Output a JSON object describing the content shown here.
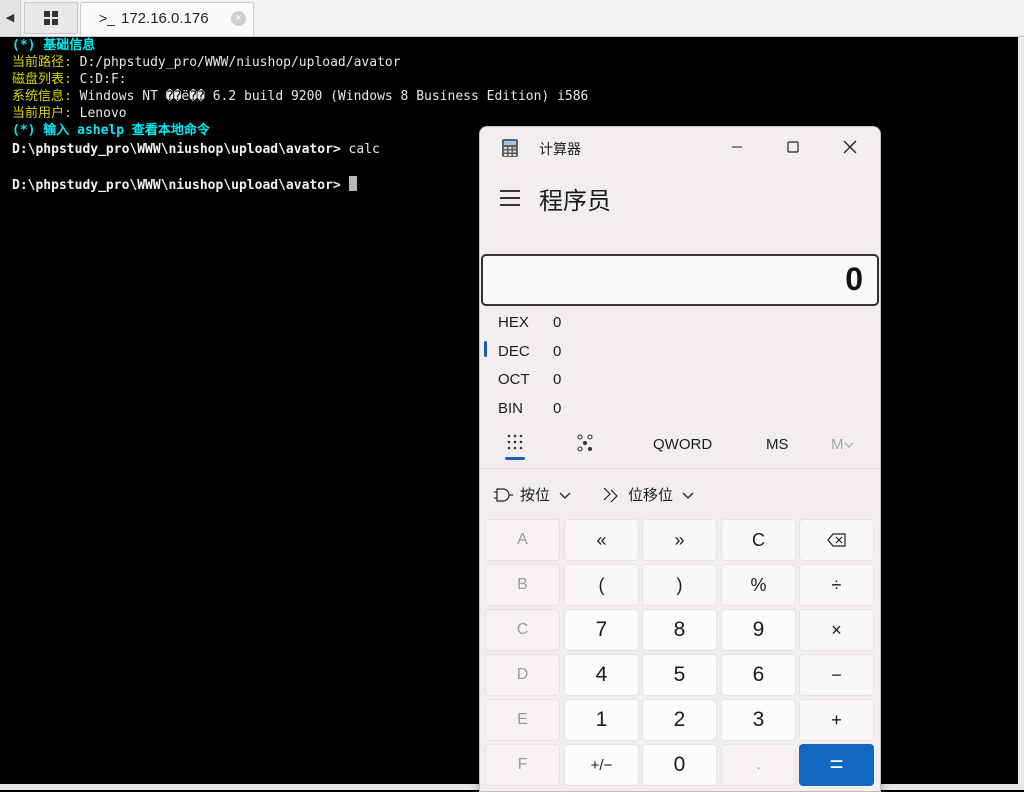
{
  "tabbar": {
    "left_arrow": "◀",
    "active_tab_icon": ">_",
    "active_tab_title": "172.16.0.176",
    "close_glyph": "×"
  },
  "terminal": {
    "line1": "(*) 基础信息",
    "line2_label": "当前路径:",
    "line2_value": " D:/phpstudy_pro/WWW/niushop/upload/avator",
    "line3_label": "磁盘列表:",
    "line3_value": " C:D:F:",
    "line4_label": "系统信息:",
    "line4_value": " Windows NT ��ë�� 6.2 build 9200 (Windows 8 Business Edition) i586",
    "line5_label": "当前用户:",
    "line5_value": " Lenovo",
    "line6": "(*) 输入 ashelp 查看本地命令",
    "prompt1": "D:\\phpstudy_pro\\WWW\\niushop\\upload\\avator> ",
    "command1": "calc",
    "prompt2": "D:\\phpstudy_pro\\WWW\\niushop\\upload\\avator> "
  },
  "calculator": {
    "window_title": "计算器",
    "mode_title": "程序员",
    "display_value": "0",
    "radix": {
      "hex_label": "HEX",
      "hex_value": "0",
      "dec_label": "DEC",
      "dec_value": "0",
      "oct_label": "OCT",
      "oct_value": "0",
      "bin_label": "BIN",
      "bin_value": "0"
    },
    "word_size": "QWORD",
    "memory_store": "MS",
    "memory_menu": "M",
    "bitwise_label": "按位",
    "bitshift_label": "位移位",
    "keys": {
      "a": "A",
      "lsh": "«",
      "rsh": "»",
      "clear": "C",
      "b": "B",
      "lparen": "(",
      "rparen": ")",
      "percent": "%",
      "divide": "÷",
      "c": "C",
      "seven": "7",
      "eight": "8",
      "nine": "9",
      "multiply": "×",
      "d": "D",
      "four": "4",
      "five": "5",
      "six": "6",
      "minus": "−",
      "e": "E",
      "one": "1",
      "two": "2",
      "three": "3",
      "plus": "+",
      "f": "F",
      "negate": "+/−",
      "zero": "0",
      "decimal": ".",
      "equals": "="
    }
  }
}
